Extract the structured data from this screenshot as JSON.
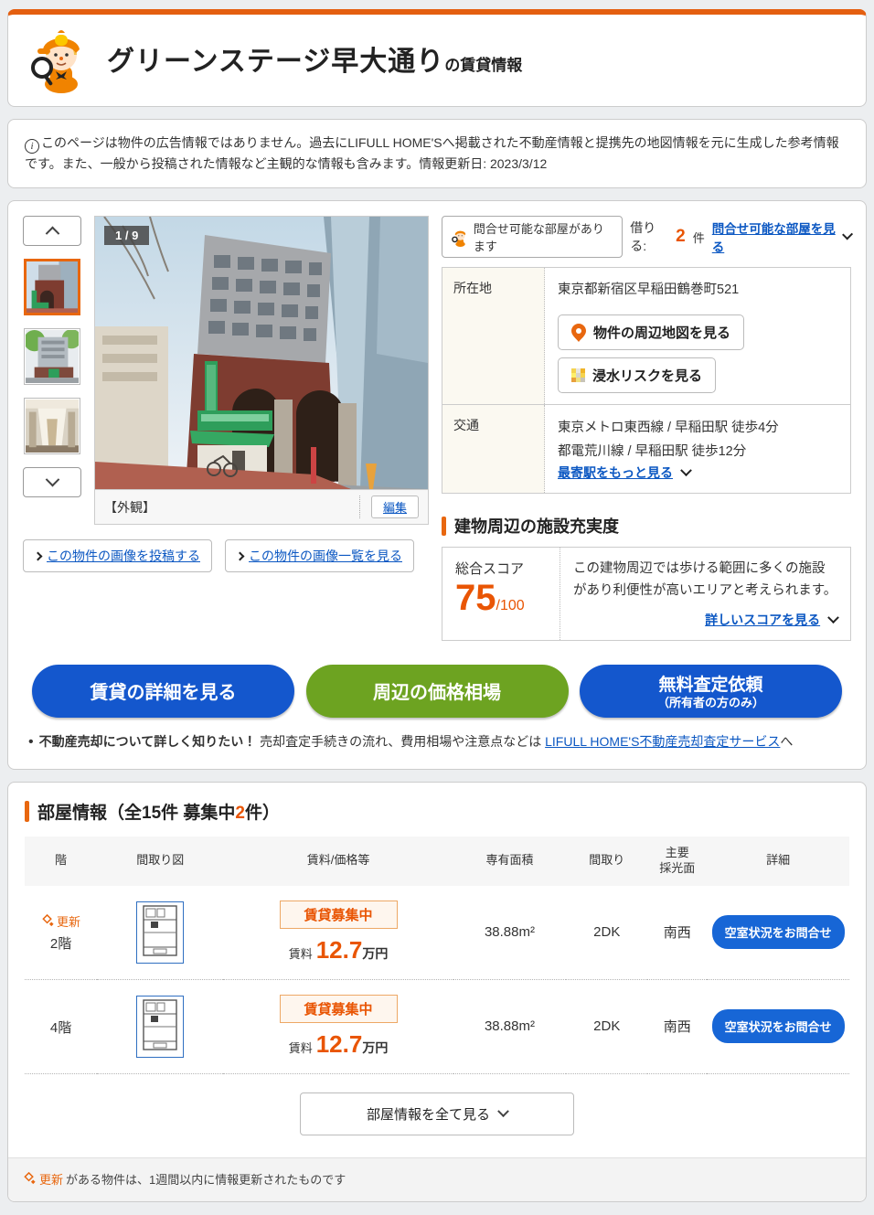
{
  "colors": {
    "accent_orange": "#e8670f",
    "text_orange": "#e95504",
    "link_blue": "#0b57c2",
    "button_blue": "#1457cd",
    "button_green": "#6da321"
  },
  "header": {
    "title": "グリーンステージ早大通り",
    "suffix": "の賃貸情報"
  },
  "notice": {
    "text": "このページは物件の広告情報ではありません。過去にLIFULL HOME'Sへ掲載された不動産情報と提携先の地図情報を元に生成した参考情報です。また、一般から投稿された情報など主観的な情報も含みます。",
    "update_label": "情報更新日:",
    "update_date": "2023/3/12"
  },
  "gallery": {
    "counter": "1 / 9",
    "caption": "【外観】",
    "edit_label": "編集",
    "post_link": "この物件の画像を投稿する",
    "list_link": "この物件の画像一覧を見る"
  },
  "inquiry": {
    "badge": "問合せ可能な部屋があります",
    "borrow_label": "借りる:",
    "count": "2",
    "count_unit": "件",
    "link": "問合せ可能な部屋を見る"
  },
  "property": {
    "location_label": "所在地",
    "address": "東京都新宿区早稲田鶴巻町521",
    "map_button": "物件の周辺地図を見る",
    "flood_button": "浸水リスクを見る",
    "access_label": "交通",
    "access_line1": "東京メトロ東西線 / 早稲田駅 徒歩4分",
    "access_line2": "都電荒川線 / 早稲田駅 徒歩12分",
    "more_stations_link": "最寄駅をもっと見る"
  },
  "facility": {
    "title": "建物周辺の施設充実度",
    "score_label": "総合スコア",
    "score": "75",
    "score_max": "/100",
    "description": "この建物周辺では歩ける範囲に多くの施設があり利便性が高いエリアと考えられます。",
    "detail_link": "詳しいスコアを見る"
  },
  "cta": {
    "rental_detail": "賃貸の詳細を見る",
    "price_market": "周辺の価格相場",
    "appraisal_main": "無料査定依頼",
    "appraisal_sub": "（所有者の方のみ）"
  },
  "sell_note": {
    "bold": "不動産売却について詳しく知りたい！",
    "body": "売却査定手続きの流れ、費用相場や注意点などは",
    "link": "LIFULL HOME'S不動産売却査定サービス",
    "suffix": "へ"
  },
  "rooms": {
    "title_prefix": "部屋情報（全15件 募集中",
    "title_count": "2",
    "title_suffix": "件）",
    "columns": {
      "floor": "階",
      "plan": "間取り図",
      "price": "賃料/価格等",
      "area": "専有面積",
      "layout": "間取り",
      "facing_line1": "主要",
      "facing_line2": "採光面",
      "detail": "詳細"
    },
    "rows": [
      {
        "update_label": "更新",
        "floor": "2階",
        "status_badge": "賃貸募集中",
        "rent_label": "賃料",
        "rent_value": "12.7",
        "rent_unit": "万円",
        "area": "38.88m²",
        "layout": "2DK",
        "facing": "南西",
        "detail_button": "空室状況をお問合せ"
      },
      {
        "floor": "4階",
        "status_badge": "賃貸募集中",
        "rent_label": "賃料",
        "rent_value": "12.7",
        "rent_unit": "万円",
        "area": "38.88m²",
        "layout": "2DK",
        "facing": "南西",
        "detail_button": "空室状況をお問合せ"
      }
    ],
    "show_all": "部屋情報を全て見る",
    "footer_update_label": "更新",
    "footer_note": "がある物件は、1週間以内に情報更新されたものです"
  }
}
